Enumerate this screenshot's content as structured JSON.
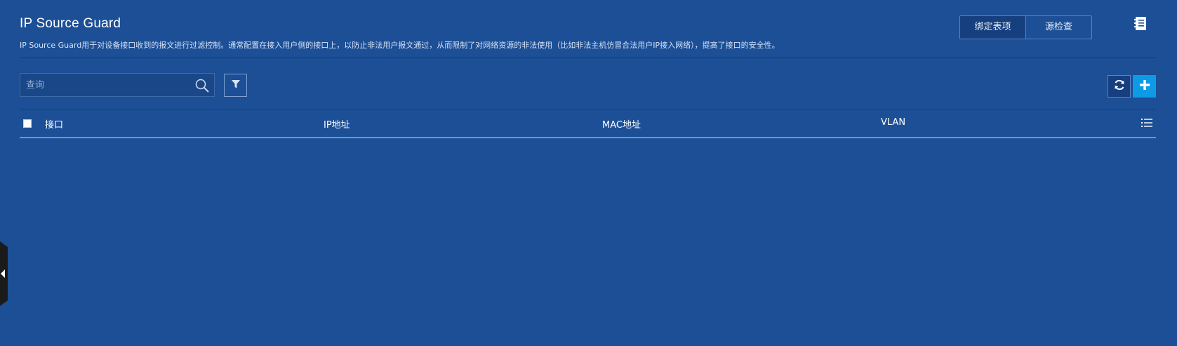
{
  "header": {
    "title": "IP Source Guard",
    "description": "IP Source Guard用于对设备接口收到的报文进行过滤控制。通常配置在接入用户侧的接口上，以防止非法用户报文通过，从而限制了对网络资源的非法使用（比如非法主机仿冒合法用户IP接入网络），提高了接口的安全性。"
  },
  "tabs": [
    {
      "label": "绑定表项",
      "active": true
    },
    {
      "label": "源检查",
      "active": false
    }
  ],
  "toolbar": {
    "search_placeholder": "查询",
    "search_value": ""
  },
  "table": {
    "columns": [
      "接口",
      "IP地址",
      "MAC地址",
      "VLAN"
    ],
    "rows": []
  },
  "icons": {
    "doc": "notebook-icon",
    "search": "search-icon",
    "filter": "filter-icon",
    "refresh": "refresh-icon",
    "add": "plus-icon",
    "column_settings": "list-icon",
    "collapse": "chevron-left-icon"
  },
  "colors": {
    "background": "#1c4f96",
    "accent": "#0d9be6",
    "active_tab": "#153f7e"
  }
}
